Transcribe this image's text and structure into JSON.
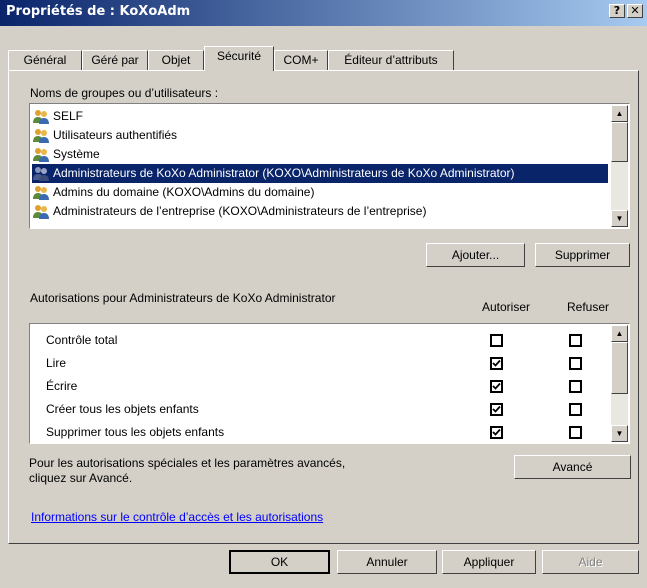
{
  "window": {
    "title": "Propriétés de : KoXoAdm",
    "help_label": "?",
    "close_label": "✕"
  },
  "tabs": [
    {
      "label": "Général"
    },
    {
      "label": "Géré par"
    },
    {
      "label": "Objet"
    },
    {
      "label": "Sécurité",
      "active": true
    },
    {
      "label": "COM+"
    },
    {
      "label": "Éditeur d’attributs"
    }
  ],
  "groups": {
    "label": "Noms de groupes ou d’utilisateurs :",
    "items": [
      {
        "text": "SELF"
      },
      {
        "text": "Utilisateurs authentifiés"
      },
      {
        "text": "Système"
      },
      {
        "text": "Administrateurs de KoXo Administrator (KOXO\\Administrateurs de KoXo Administrator)",
        "selected": true
      },
      {
        "text": "Admins du domaine (KOXO\\Admins du domaine)"
      },
      {
        "text": "Administrateurs de l’entreprise (KOXO\\Administrateurs de l’entreprise)"
      }
    ],
    "add_label": "Ajouter...",
    "remove_label": "Supprimer"
  },
  "permissions": {
    "label": "Autorisations pour Administrateurs de KoXo Administrator",
    "allow_header": "Autoriser",
    "deny_header": "Refuser",
    "rows": [
      {
        "name": "Contrôle total",
        "allow": false,
        "deny": false
      },
      {
        "name": "Lire",
        "allow": true,
        "deny": false
      },
      {
        "name": "Écrire",
        "allow": true,
        "deny": false
      },
      {
        "name": "Créer tous les objets enfants",
        "allow": true,
        "deny": false
      },
      {
        "name": "Supprimer tous les objets enfants",
        "allow": true,
        "deny": false
      }
    ]
  },
  "advanced": {
    "text": "Pour les autorisations spéciales et les paramètres avancés, cliquez sur Avancé.",
    "button_label": "Avancé"
  },
  "info_link": "Informations sur le contrôle d’accès et les autorisations",
  "footer": {
    "ok_label": "OK",
    "cancel_label": "Annuler",
    "apply_label": "Appliquer",
    "help_label": "Aide"
  },
  "colors": {
    "title_bar": "#0a246a",
    "selection": "#0a246a",
    "dialog_bg": "#d4d0c8",
    "link": "#0000ff"
  }
}
